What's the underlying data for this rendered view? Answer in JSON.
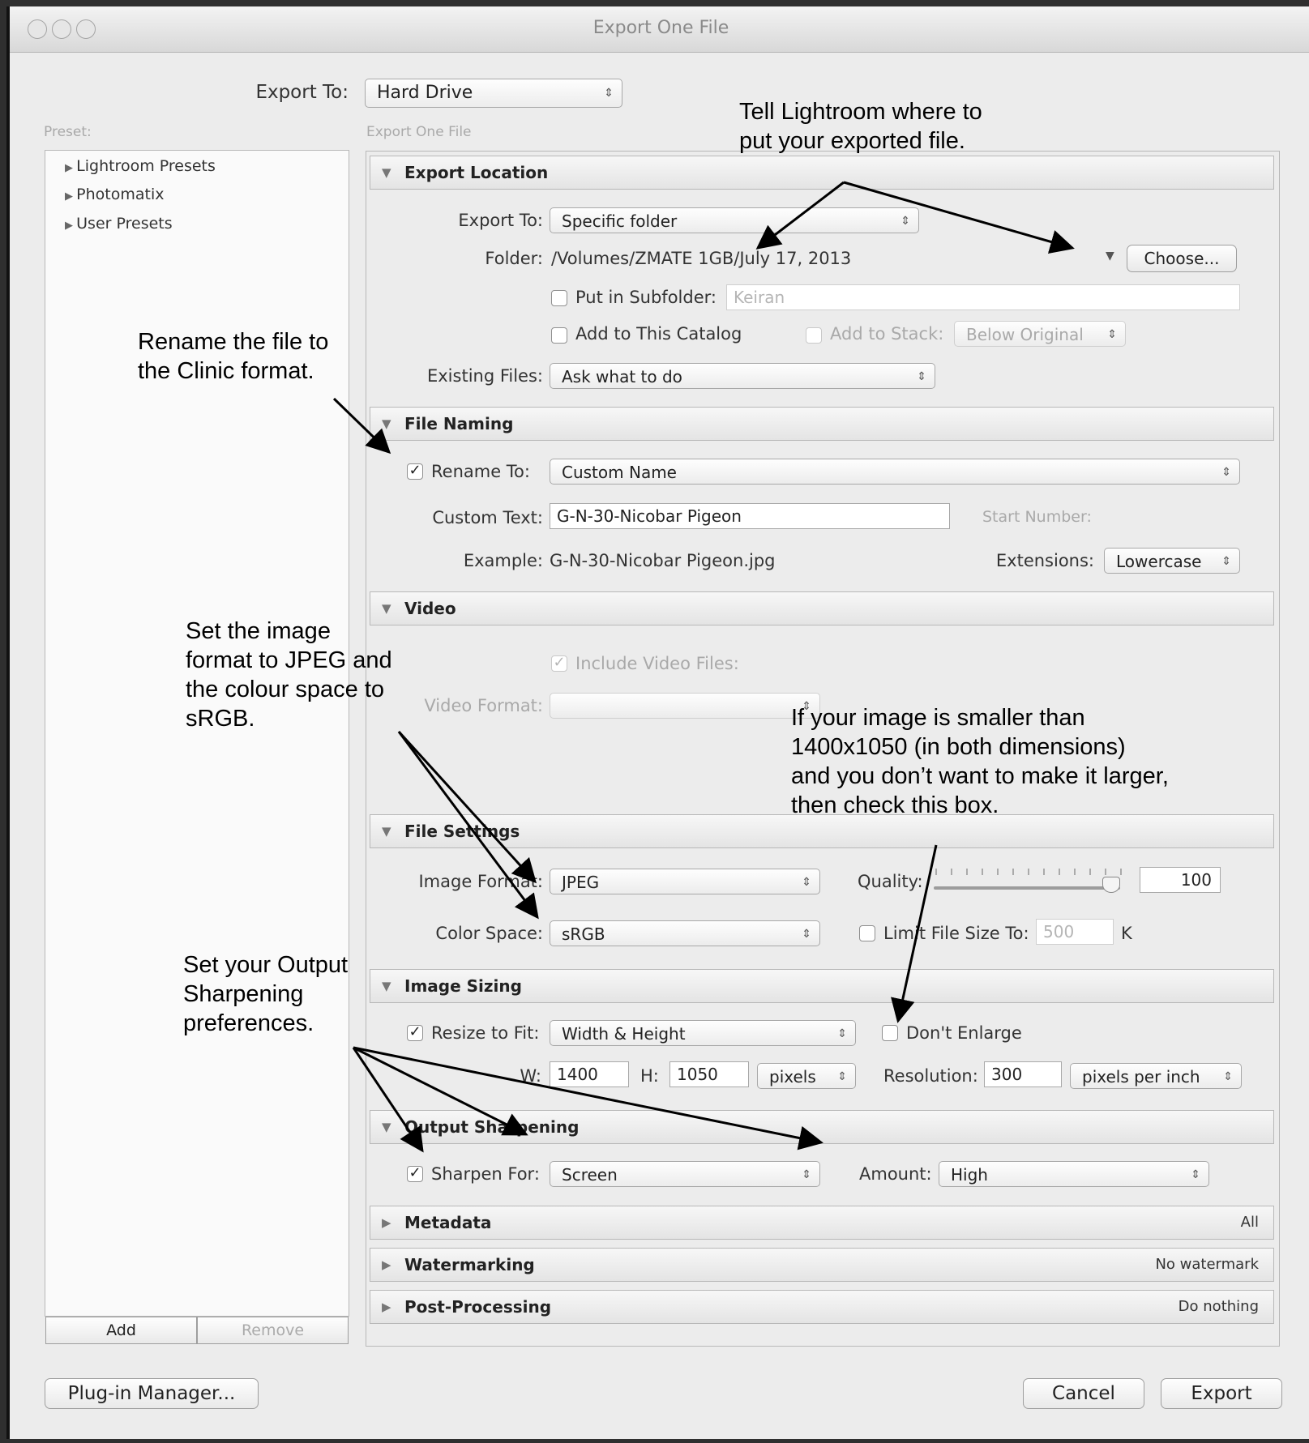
{
  "window": {
    "title": "Export One File"
  },
  "header": {
    "export_to_label": "Export To:",
    "export_to_value": "Hard Drive"
  },
  "preset_panel": {
    "label": "Preset:",
    "items": [
      "Lightroom Presets",
      "Photomatix",
      "User Presets"
    ],
    "add_label": "Add",
    "remove_label": "Remove"
  },
  "main": {
    "caption": "Export One File"
  },
  "export_location": {
    "title": "Export Location",
    "export_to_label": "Export To:",
    "export_to_value": "Specific folder",
    "folder_label": "Folder:",
    "folder_value": "/Volumes/ZMATE 1GB/July 17, 2013",
    "choose_label": "Choose...",
    "subfolder_label": "Put in Subfolder:",
    "subfolder_value": "Keiran",
    "add_catalog_label": "Add to This Catalog",
    "add_stack_label": "Add to Stack:",
    "add_stack_value": "Below Original",
    "existing_label": "Existing Files:",
    "existing_value": "Ask what to do"
  },
  "file_naming": {
    "title": "File Naming",
    "rename_label": "Rename To:",
    "rename_value": "Custom Name",
    "custom_text_label": "Custom Text:",
    "custom_text_value": "G-N-30-Nicobar Pigeon",
    "start_number_label": "Start Number:",
    "example_label": "Example:",
    "example_value": "G-N-30-Nicobar Pigeon.jpg",
    "extensions_label": "Extensions:",
    "extensions_value": "Lowercase"
  },
  "video": {
    "title": "Video",
    "include_label": "Include Video Files:",
    "format_label": "Video Format:"
  },
  "file_settings": {
    "title": "File Settings",
    "format_label": "Image Format:",
    "format_value": "JPEG",
    "quality_label": "Quality:",
    "quality_value": "100",
    "quality_fraction": 1.0,
    "color_space_label": "Color Space:",
    "color_space_value": "sRGB",
    "limit_label": "Limit File Size To:",
    "limit_value": "500",
    "limit_unit": "K"
  },
  "image_sizing": {
    "title": "Image Sizing",
    "resize_label": "Resize to Fit:",
    "resize_value": "Width & Height",
    "dont_enlarge_label": "Don't Enlarge",
    "w_label": "W:",
    "w_value": "1400",
    "h_label": "H:",
    "h_value": "1050",
    "unit_value": "pixels",
    "resolution_label": "Resolution:",
    "resolution_value": "300",
    "resolution_unit": "pixels per inch"
  },
  "output_sharpening": {
    "title": "Output Sharpening",
    "sharpen_label": "Sharpen For:",
    "sharpen_value": "Screen",
    "amount_label": "Amount:",
    "amount_value": "High"
  },
  "metadata": {
    "title": "Metadata",
    "summary": "All"
  },
  "watermarking": {
    "title": "Watermarking",
    "summary": "No watermark"
  },
  "post_processing": {
    "title": "Post-Processing",
    "summary": "Do nothing"
  },
  "footer": {
    "plugin_label": "Plug-in Manager...",
    "cancel_label": "Cancel",
    "export_label": "Export"
  },
  "annotations": {
    "location": [
      "Tell Lightroom where to",
      "put your exported file."
    ],
    "rename": [
      "Rename the file to",
      "the Clinic format."
    ],
    "format": [
      "Set the image",
      "format to JPEG and",
      "the colour space to",
      "sRGB."
    ],
    "enlarge": [
      "If your image is smaller than",
      "1400x1050 (in both dimensions)",
      "and you don’t want to make it larger,",
      "then check this box."
    ],
    "sharpening": [
      "Set your Output",
      "Sharpening",
      "preferences."
    ]
  },
  "icons": {
    "disclosure_open": "▼",
    "disclosure_closed": "▶",
    "popup_arrows": "↕",
    "checkmark": "✓"
  }
}
